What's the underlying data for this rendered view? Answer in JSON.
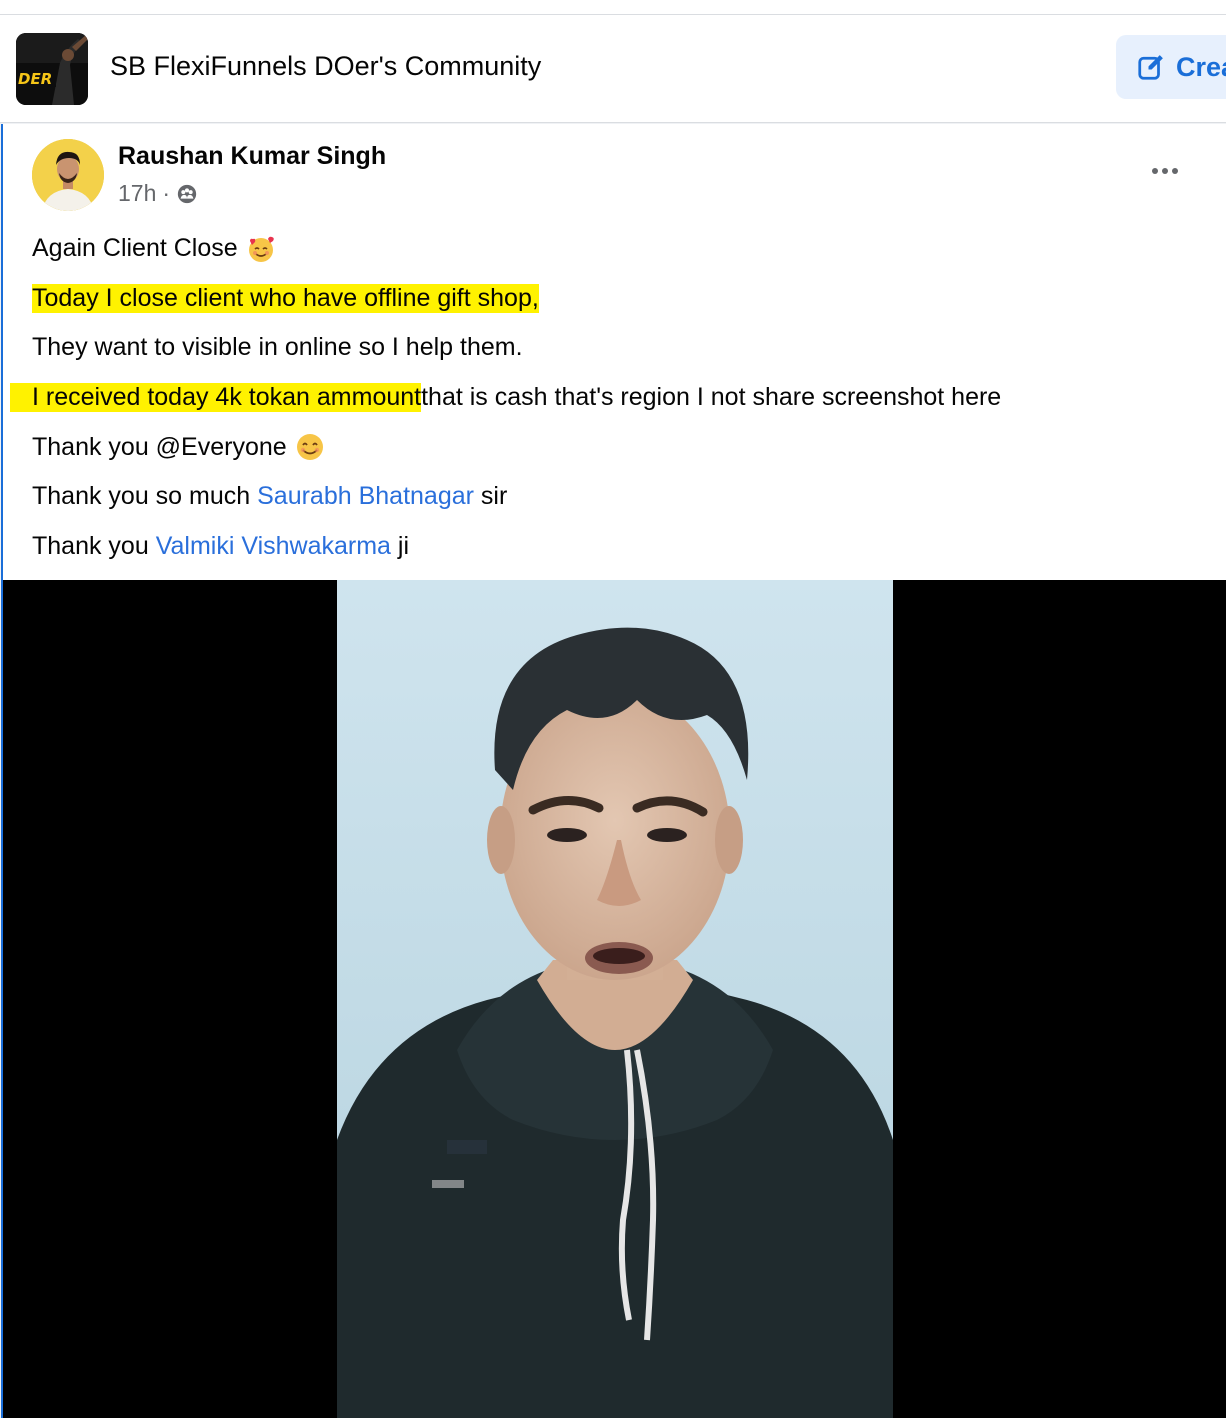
{
  "group": {
    "name": "SB FlexiFunnels DOer's Community",
    "thumb_text": "DER",
    "create_label": "Crea"
  },
  "post": {
    "author": "Raushan Kumar Singh",
    "time": "17h",
    "separator": "·",
    "privacy_icon": "group-audience-icon",
    "lines": {
      "l1": "Again Client Close",
      "l2": "Today I close client who have offline gift shop,",
      "l3": "They want to visible in online so I help them.",
      "l4_highlight": "I received today 4k tokan ammount",
      "l4_rest": " that is cash that's region I not share screenshot here",
      "l5": "Thank you @Everyone",
      "l6_prefix": "Thank you so much ",
      "l6_mention": "Saurabh Bhatnagar",
      "l6_suffix": " sir",
      "l7_prefix": "Thank you ",
      "l7_mention": "Valmiki Vishwakarma",
      "l7_suffix": " ji"
    }
  },
  "colors": {
    "highlight": "#fff200",
    "mention": "#2a6fdb",
    "accent": "#1a6ed8"
  }
}
